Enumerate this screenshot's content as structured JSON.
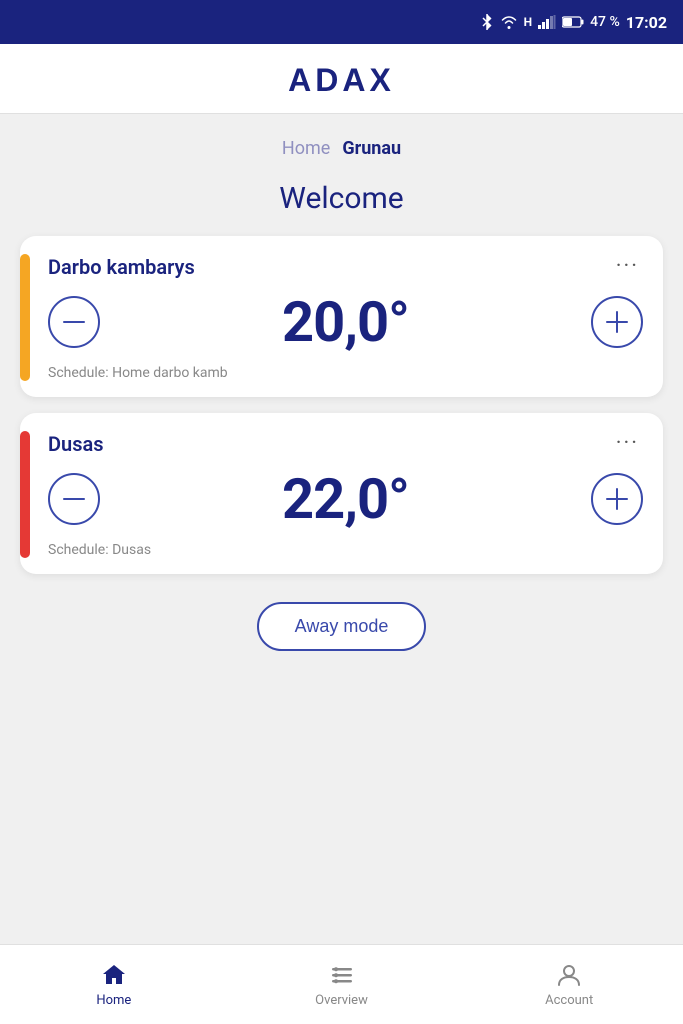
{
  "statusBar": {
    "battery": "47 %",
    "time": "17:02"
  },
  "header": {
    "logo": "ADAX"
  },
  "breadcrumb": {
    "items": [
      {
        "label": "Home",
        "active": false
      },
      {
        "label": "Grunau",
        "active": true
      }
    ]
  },
  "welcome": {
    "title": "Welcome"
  },
  "devices": [
    {
      "id": "darbo-kambarys",
      "name": "Darbo kambarys",
      "temperature": "20,0°",
      "schedule": "Schedule: Home darbo kamb",
      "accent": "yellow"
    },
    {
      "id": "dusas",
      "name": "Dusas",
      "temperature": "22,0°",
      "schedule": "Schedule: Dusas",
      "accent": "red"
    }
  ],
  "awayMode": {
    "label": "Away mode"
  },
  "bottomNav": {
    "items": [
      {
        "id": "home",
        "label": "Home",
        "active": true
      },
      {
        "id": "overview",
        "label": "Overview",
        "active": false
      },
      {
        "id": "account",
        "label": "Account",
        "active": false
      }
    ]
  }
}
